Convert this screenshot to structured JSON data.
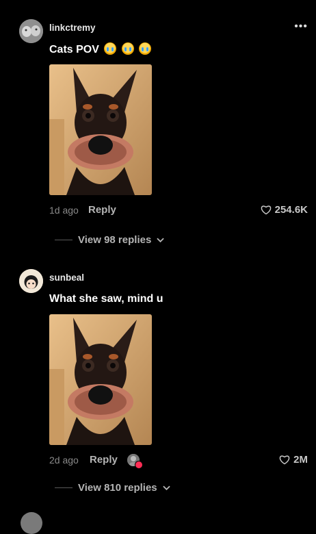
{
  "comments": [
    {
      "username": "linkctremy",
      "text": "Cats POV",
      "emojis": [
        "crying-face-emoji",
        "crying-face-emoji",
        "crying-face-emoji"
      ],
      "time": "1d ago",
      "reply_label": "Reply",
      "likes": "254.6K",
      "view_replies": "View 98 replies"
    },
    {
      "username": "sunbeal",
      "text": "What she saw, mind u",
      "time": "2d ago",
      "reply_label": "Reply",
      "likes": "2M",
      "view_replies": "View 810 replies"
    }
  ],
  "more_icon": "•••",
  "colors": {
    "background": "#000000",
    "muted": "#8a8a8a",
    "heart_badge": "#ff2d55"
  }
}
